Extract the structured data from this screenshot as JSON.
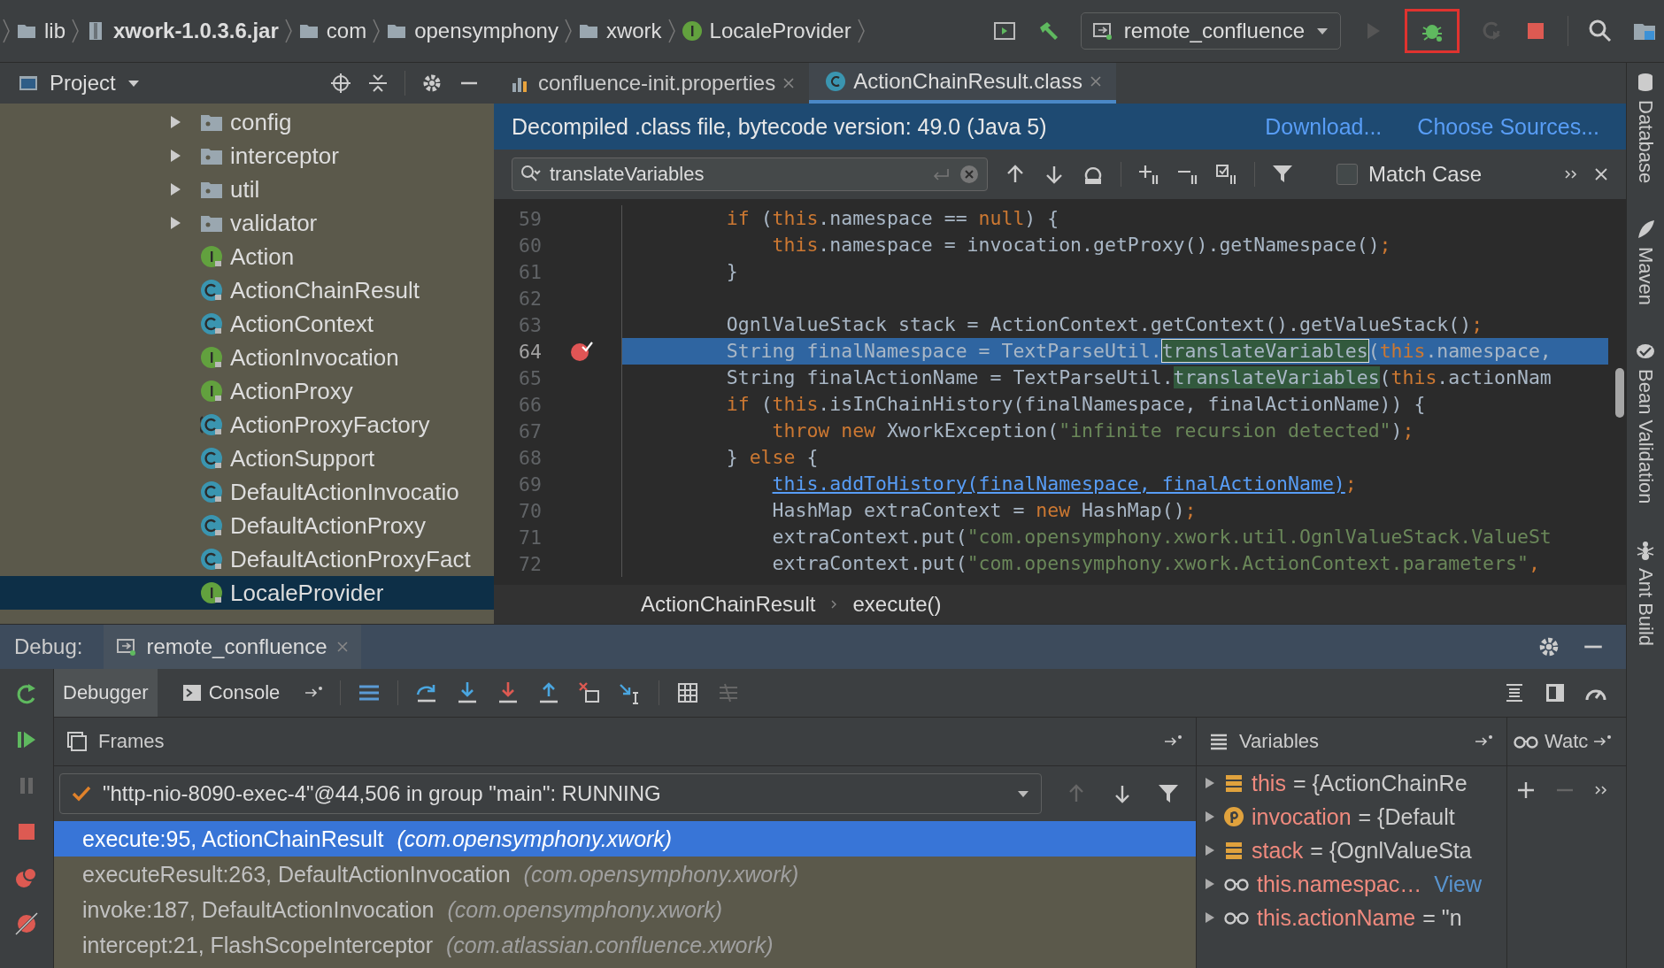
{
  "nav_bar": {
    "crumbs": [
      {
        "label": "lib",
        "kind": "folder"
      },
      {
        "label": "xwork-1.0.3.6.jar",
        "kind": "jar"
      },
      {
        "label": "com",
        "kind": "folder"
      },
      {
        "label": "opensymphony",
        "kind": "folder"
      },
      {
        "label": "xwork",
        "kind": "folder"
      },
      {
        "label": "LocaleProvider",
        "kind": "interface"
      }
    ],
    "run_config": "remote_confluence"
  },
  "project_panel": {
    "title": "Project",
    "items": [
      {
        "label": "config",
        "kind": "folder",
        "expanded": false,
        "selected": false
      },
      {
        "label": "interceptor",
        "kind": "folder",
        "expanded": false,
        "selected": false
      },
      {
        "label": "util",
        "kind": "folder",
        "expanded": false,
        "selected": false
      },
      {
        "label": "validator",
        "kind": "folder",
        "expanded": false,
        "selected": false
      },
      {
        "label": "Action",
        "kind": "interface",
        "selected": false
      },
      {
        "label": "ActionChainResult",
        "kind": "class",
        "selected": false
      },
      {
        "label": "ActionContext",
        "kind": "class",
        "selected": false
      },
      {
        "label": "ActionInvocation",
        "kind": "interface",
        "selected": false
      },
      {
        "label": "ActionProxy",
        "kind": "interface",
        "selected": false
      },
      {
        "label": "ActionProxyFactory",
        "kind": "abstract",
        "selected": false
      },
      {
        "label": "ActionSupport",
        "kind": "class",
        "selected": false
      },
      {
        "label": "DefaultActionInvocatio",
        "kind": "class",
        "selected": false
      },
      {
        "label": "DefaultActionProxy",
        "kind": "class",
        "selected": false
      },
      {
        "label": "DefaultActionProxyFact",
        "kind": "class",
        "selected": false
      },
      {
        "label": "LocaleProvider",
        "kind": "interface",
        "selected": true
      }
    ]
  },
  "editor": {
    "tabs": [
      {
        "label": "confluence-init.properties",
        "kind": "properties",
        "selected": false
      },
      {
        "label": "ActionChainResult.class",
        "kind": "class",
        "selected": true
      }
    ],
    "banner": {
      "text": "Decompiled .class file, bytecode version: 49.0 (Java 5)",
      "links": [
        "Download...",
        "Choose Sources..."
      ]
    },
    "search": {
      "value": "translateVariables",
      "match_case": {
        "label": "Match Case",
        "checked": false
      }
    },
    "lines": [
      {
        "number": "59",
        "current": false,
        "breakpoint": false,
        "tokens": [
          {
            "text": "    if",
            "kind": "keyword"
          },
          {
            "text": " (",
            "kind": "text"
          },
          {
            "text": "this",
            "kind": "keyword"
          },
          {
            "text": ".namespace == ",
            "kind": "text"
          },
          {
            "text": "null",
            "kind": "keyword"
          },
          {
            "text": ") {",
            "kind": "text"
          }
        ]
      },
      {
        "number": "60",
        "current": false,
        "breakpoint": false,
        "tokens": [
          {
            "text": "        this",
            "kind": "keyword"
          },
          {
            "text": ".namespace = invocation.getProxy().getNamespace()",
            "kind": "text"
          },
          {
            "text": ";",
            "kind": "keyword"
          }
        ]
      },
      {
        "number": "61",
        "current": false,
        "breakpoint": false,
        "tokens": [
          {
            "text": "    }",
            "kind": "text"
          }
        ]
      },
      {
        "number": "62",
        "current": false,
        "breakpoint": false
      },
      {
        "number": "63",
        "current": false,
        "breakpoint": false,
        "tokens": [
          {
            "text": "    OgnlValueStack stack = ActionContext.getContext().getValueStack()",
            "kind": "text"
          },
          {
            "text": ";",
            "kind": "keyword"
          }
        ]
      },
      {
        "number": "64",
        "current": true,
        "breakpoint": true,
        "tokens": [
          {
            "text": "    String finalNamespace = TextParseUtil.",
            "kind": "text"
          },
          {
            "text": "translateVariables",
            "kind": "match_current"
          },
          {
            "text": "(",
            "kind": "text"
          },
          {
            "text": "this",
            "kind": "keyword"
          },
          {
            "text": ".namespace,",
            "kind": "text"
          }
        ]
      },
      {
        "number": "65",
        "current": false,
        "breakpoint": false,
        "tokens": [
          {
            "text": "    String finalActionName = TextParseUtil.",
            "kind": "text"
          },
          {
            "text": "translateVariables",
            "kind": "match"
          },
          {
            "text": "(",
            "kind": "text"
          },
          {
            "text": "this",
            "kind": "keyword"
          },
          {
            "text": ".actionNam",
            "kind": "text"
          }
        ]
      },
      {
        "number": "66",
        "current": false,
        "breakpoint": false,
        "tokens": [
          {
            "text": "    if",
            "kind": "keyword"
          },
          {
            "text": " (",
            "kind": "text"
          },
          {
            "text": "this",
            "kind": "keyword"
          },
          {
            "text": ".isInChainHistory(finalNamespace, finalActionName)) {",
            "kind": "text"
          }
        ]
      },
      {
        "number": "67",
        "current": false,
        "breakpoint": false,
        "tokens": [
          {
            "text": "        throw new",
            "kind": "keyword"
          },
          {
            "text": " XworkException(",
            "kind": "text"
          },
          {
            "text": "\"infinite recursion detected\"",
            "kind": "string"
          },
          {
            "text": ")",
            "kind": "text"
          },
          {
            "text": ";",
            "kind": "keyword"
          }
        ]
      },
      {
        "number": "68",
        "current": false,
        "breakpoint": false,
        "tokens": [
          {
            "text": "    } ",
            "kind": "text"
          },
          {
            "text": "else",
            "kind": "keyword"
          },
          {
            "text": " {",
            "kind": "text"
          }
        ]
      },
      {
        "number": "69",
        "current": false,
        "breakpoint": false,
        "tokens": [
          {
            "text": "        this.addToHistory(finalNamespace, finalActionName)",
            "kind": "link"
          },
          {
            "text": ";",
            "kind": "keyword"
          }
        ]
      },
      {
        "number": "70",
        "current": false,
        "breakpoint": false,
        "tokens": [
          {
            "text": "        HashMap extraContext = ",
            "kind": "text"
          },
          {
            "text": "new",
            "kind": "keyword"
          },
          {
            "text": " HashMap()",
            "kind": "text"
          },
          {
            "text": ";",
            "kind": "keyword"
          }
        ]
      },
      {
        "number": "71",
        "current": false,
        "breakpoint": false,
        "tokens": [
          {
            "text": "        extraContext.put(",
            "kind": "text"
          },
          {
            "text": "\"com.opensymphony.xwork.util.OgnlValueStack.ValueSt",
            "kind": "string"
          }
        ]
      },
      {
        "number": "72",
        "current": false,
        "breakpoint": false,
        "tokens": [
          {
            "text": "        extraContext.put(",
            "kind": "text"
          },
          {
            "text": "\"com.opensymphony.xwork.ActionContext.parameters\"",
            "kind": "string"
          },
          {
            "text": ",",
            "kind": "keyword"
          }
        ]
      }
    ],
    "breadcrumbs": [
      "ActionChainResult",
      "execute()"
    ]
  },
  "tool_strip": [
    "Database",
    "Maven",
    "Bean Validation",
    "Ant Build"
  ],
  "debug": {
    "title": "Debug:",
    "session_tab": "remote_confluence",
    "tabs": [
      {
        "label": "Debugger",
        "selected": true
      },
      {
        "label": "Console",
        "selected": false
      }
    ],
    "frames": {
      "title": "Frames",
      "thread": "\"http-nio-8090-exec-4\"@44,506 in group \"main\": RUNNING",
      "items": [
        {
          "method": "execute:95, ActionChainResult",
          "package": "(com.opensymphony.xwork)",
          "selected": true
        },
        {
          "method": "executeResult:263, DefaultActionInvocation",
          "package": "(com.opensymphony.xwork)",
          "selected": false
        },
        {
          "method": "invoke:187, DefaultActionInvocation",
          "package": "(com.opensymphony.xwork)",
          "selected": false
        },
        {
          "method": "intercept:21, FlashScopeInterceptor",
          "package": "(com.atlassian.confluence.xwork)",
          "selected": false
        }
      ]
    },
    "variables": {
      "title": "Variables",
      "items": [
        {
          "kind": "field",
          "name": "this",
          "value": "= {ActionChainRe"
        },
        {
          "kind": "param",
          "name": "invocation",
          "value": "= {Default"
        },
        {
          "kind": "field",
          "name": "stack",
          "value": "= {OgnlValueSta"
        },
        {
          "kind": "watch",
          "name": "this.namespac…",
          "link": "View"
        },
        {
          "kind": "watch",
          "name": "this.actionName",
          "value": "= \"n"
        }
      ]
    },
    "watches": {
      "title": "Watc"
    }
  }
}
